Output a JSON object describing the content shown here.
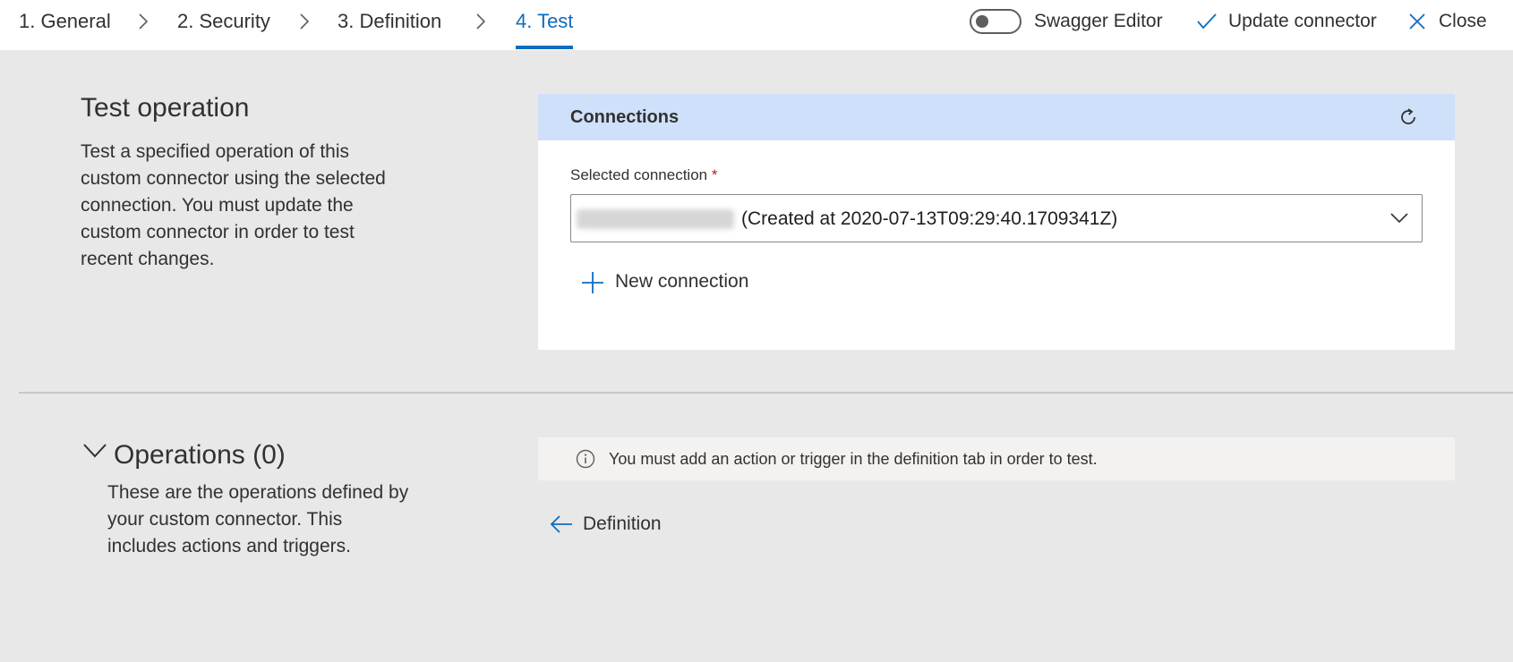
{
  "wizard": {
    "steps": [
      {
        "label": "1. General"
      },
      {
        "label": "2. Security"
      },
      {
        "label": "3. Definition"
      },
      {
        "label": "4. Test"
      }
    ],
    "active_step": "4. Test"
  },
  "commands": {
    "swagger_editor": "Swagger Editor",
    "swagger_editor_on": false,
    "update_connector": "Update connector",
    "close": "Close"
  },
  "test_operation": {
    "title": "Test operation",
    "description": "Test a specified operation of this custom connector using the selected connection. You must update the custom connector in order to test recent changes."
  },
  "connections": {
    "title": "Connections",
    "selected_label": "Selected connection",
    "required_marker": "*",
    "selected_value": "(Created at 2020-07-13T09:29:40.1709341Z)",
    "new_connection": "New connection"
  },
  "operations": {
    "title": "Operations (0)",
    "description": "These are the operations defined by your custom connector. This includes actions and triggers.",
    "info_message": "You must add an action or trigger in the definition tab in order to test.",
    "definition_link": "Definition"
  },
  "colors": {
    "accent": "#0f6cbd",
    "card_header": "#cfe0fa",
    "background": "#e8e8e8"
  }
}
